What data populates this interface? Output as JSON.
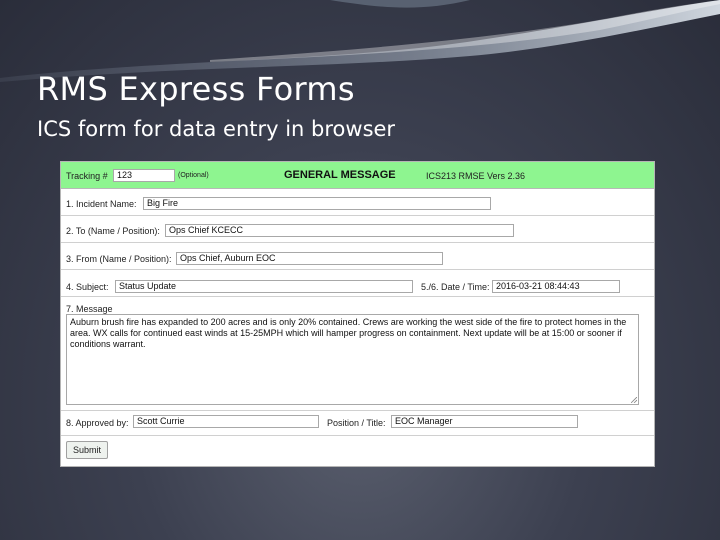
{
  "slide": {
    "title": "RMS Express Forms",
    "subtitle": "ICS form for data entry in browser"
  },
  "form": {
    "header": {
      "tracking_label": "Tracking #",
      "tracking_value": "123",
      "optional_note": "(Optional)",
      "title": "GENERAL MESSAGE",
      "version": "ICS213 RMSE Vers 2.36"
    },
    "incident": {
      "label": "1. Incident Name:",
      "value": "Big Fire"
    },
    "to": {
      "label": "2. To (Name / Position):",
      "value": "Ops Chief KCECC"
    },
    "from": {
      "label": "3. From (Name / Position):",
      "value": "Ops Chief, Auburn EOC"
    },
    "subject": {
      "label": "4. Subject:",
      "value": "Status Update"
    },
    "datetime": {
      "label": "5./6. Date / Time:",
      "value": "2016-03-21 08:44:43"
    },
    "message": {
      "label": "7. Message",
      "value": "Auburn brush fire has expanded to 200 acres and is only 20% contained. Crews are working the west side of the fire to protect homes in the area. WX calls for continued east winds at 15-25MPH which will hamper progress on containment. Next update will be at 15:00 or sooner if conditions warrant."
    },
    "approved": {
      "label": "8. Approved by:",
      "value": "Scott Currie"
    },
    "position": {
      "label": "Position / Title:",
      "value": "EOC Manager"
    },
    "submit_label": "Submit"
  },
  "colors": {
    "header_green": "#8ef590",
    "background": "#3c4050",
    "text": "#ffffff"
  }
}
